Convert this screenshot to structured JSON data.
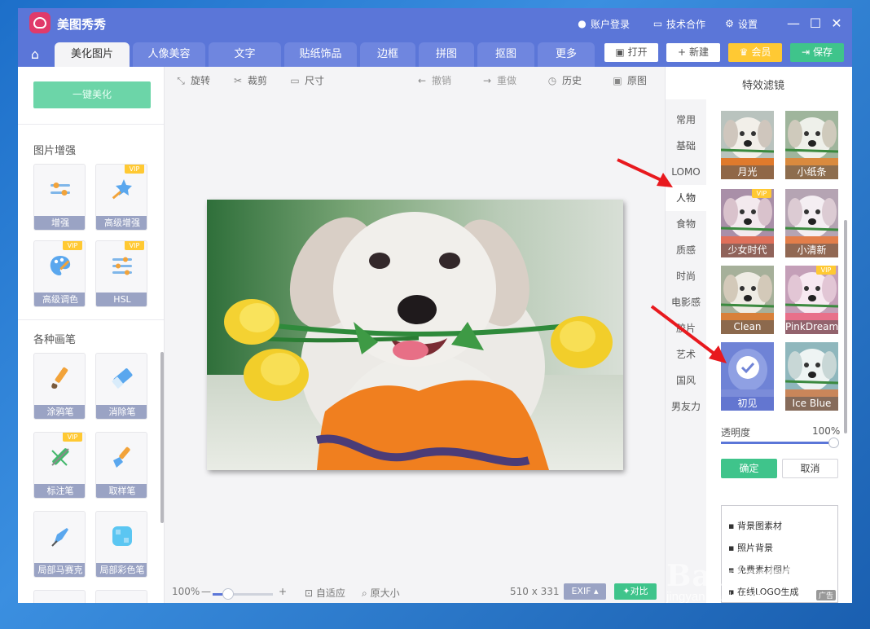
{
  "app": {
    "title": "美图秀秀"
  },
  "titlebar": {
    "login": "账户登录",
    "tech": "技术合作",
    "settings": "设置"
  },
  "tabs": [
    "美化图片",
    "人像美容",
    "文字",
    "贴纸饰品",
    "边框",
    "拼图",
    "抠图",
    "更多"
  ],
  "topbuttons": {
    "open": "打开",
    "new": "新建",
    "vip": "会员",
    "save": "保存"
  },
  "sidebar": {
    "onekey": "一键美化",
    "section1": "图片增强",
    "section2": "各种画笔",
    "vip_badge": "VIP",
    "tools": [
      "增强",
      "高级增强",
      "高级调色",
      "HSL",
      "涂鸦笔",
      "消除笔",
      "标注笔",
      "取样笔",
      "局部马赛克",
      "局部彩色笔"
    ]
  },
  "canvas_toolbar": {
    "rotate": "旋转",
    "crop": "裁剪",
    "size": "尺寸",
    "undo": "撤销",
    "redo": "重做",
    "history": "历史",
    "original": "原图"
  },
  "bottombar": {
    "zoom": "100%",
    "fit": "自适应",
    "original_size": "原大小",
    "dims": "510 x 331",
    "exif": "EXIF",
    "compare": "对比"
  },
  "rpanel": {
    "title": "特效滤镜",
    "categories": [
      "常用",
      "基础",
      "LOMO",
      "人物",
      "食物",
      "质感",
      "时尚",
      "电影感",
      "胶片",
      "艺术",
      "国风",
      "男友力"
    ],
    "filters": [
      "月光",
      "小纸条",
      "少女时代",
      "小清新",
      "Clean",
      "PinkDream",
      "初见",
      "Ice Blue"
    ],
    "opacity_label": "透明度",
    "opacity_value": "100%",
    "confirm": "确定",
    "cancel": "取消",
    "ad_lines": [
      "背景图素材",
      "照片背景",
      "免费素材图片",
      "在线LOGO生成"
    ],
    "ad_tag": "广告"
  },
  "watermark": {
    "line1": "Baidu经验",
    "line2": "jingyan.baidu.com"
  },
  "colors": {
    "brand": "#5b76d8",
    "green": "#3fc48b",
    "vip": "#ffc933",
    "arrow": "#e8191e"
  }
}
